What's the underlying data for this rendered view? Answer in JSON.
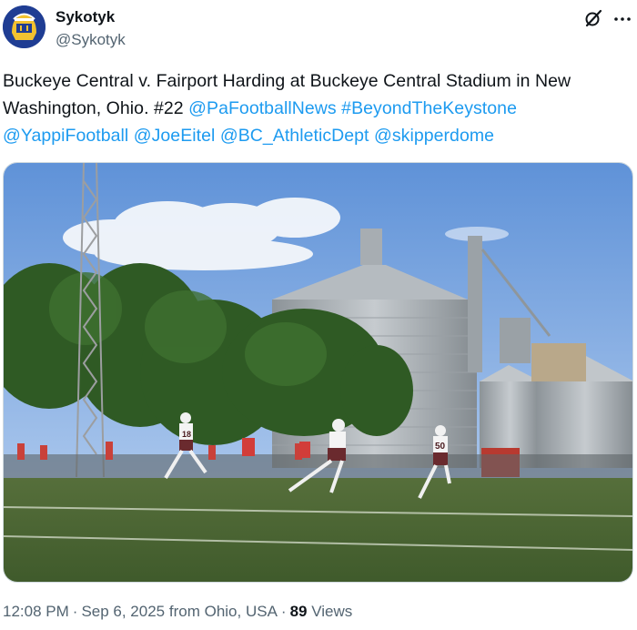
{
  "author": {
    "display_name": "Sykotyk",
    "handle": "@Sykotyk",
    "avatar_icon": "trojan-helmet-avatar-icon"
  },
  "actions": {
    "grok_icon": "grok-slash-icon",
    "more_icon": "more-dots-icon"
  },
  "tweet": {
    "text_plain": "Buckeye Central v. Fairport Harding at Buckeye Central Stadium in New Washington, Ohio. #22",
    "mentions": [
      "@PaFootballNews",
      "#BeyondTheKeystone",
      "@YappiFootball",
      "@JoeEitel",
      "@BC_AthleticDept",
      "@skipperdome"
    ]
  },
  "media": {
    "player_number_1": "18",
    "player_number_2": "50"
  },
  "meta": {
    "time": "12:08 PM",
    "date": "Sep 6, 2025",
    "location": "from Ohio, USA",
    "views_count": "89",
    "views_label": "Views",
    "separator": "·"
  },
  "colors": {
    "link": "#1d9bf0",
    "text": "#0f1419",
    "secondary": "#536471",
    "sky": "#6e9ede",
    "grass": "#4d6b35"
  }
}
